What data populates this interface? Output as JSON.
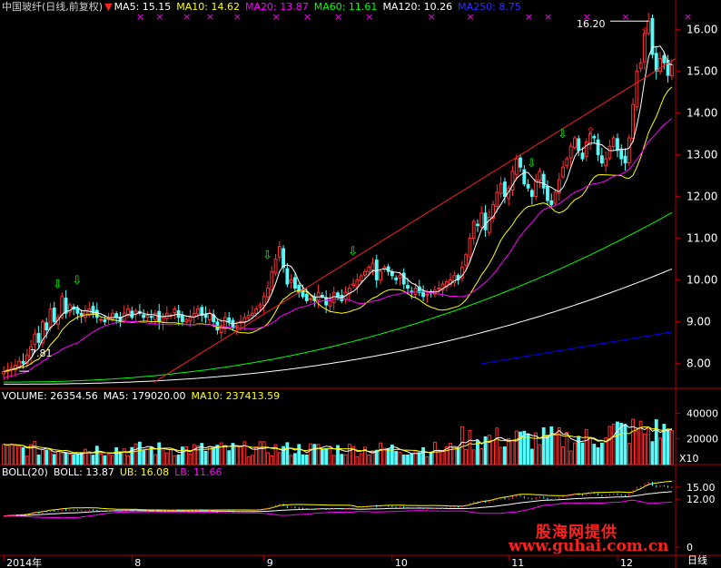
{
  "price_header": {
    "title": "中国玻纤(日线,前复权)",
    "ma5": "MA5: 15.15",
    "ma10": "MA10: 14.62",
    "ma20": "MA20: 13.87",
    "ma60": "MA60: 11.61",
    "ma120": "MA120: 10.26",
    "ma250": "MA250: 8.75"
  },
  "volume_header": {
    "vol": "VOLUME: 26354.56",
    "ma5": "MA5: 179020.00",
    "ma10": "MA10: 237413.59"
  },
  "boll_header": {
    "name": "BOLL(20)",
    "boll": "BOLL: 13.87",
    "ub": "UB: 16.08",
    "lb": "LB: 11.66"
  },
  "annotations": {
    "high": "16.20",
    "low": "7.81"
  },
  "volume_unit": "X10",
  "period_label": "日线",
  "watermark": {
    "line1": "股海网提供",
    "line2": "www.guhai.com.cn"
  },
  "colors": {
    "up": "#ff3232",
    "down": "#54fcfc",
    "ma5": "#ffffff",
    "ma10": "#ffff00",
    "ma20": "#ff00ff",
    "ma60": "#00ff00",
    "ma120": "#ffffff",
    "ma250": "#0000ff",
    "trend": "#ff2020",
    "axis": "#b00000"
  },
  "chart_data": [
    {
      "type": "candlestick",
      "title": "中国玻纤(日线,前复权)",
      "ylim": [
        7.4,
        16.4
      ],
      "y_ticks": [
        8.0,
        9.0,
        10.0,
        11.0,
        12.0,
        13.0,
        14.0,
        15.0,
        16.0
      ],
      "x_labels": [
        "2014年",
        "8",
        "9",
        "10",
        "11",
        "12"
      ],
      "x_label_index": [
        0,
        33,
        67,
        100,
        130,
        158
      ],
      "close_estimated": [
        7.8,
        7.85,
        7.9,
        7.95,
        8.05,
        8.0,
        8.2,
        8.4,
        8.7,
        8.5,
        9.0,
        8.8,
        9.3,
        9.0,
        9.1,
        9.6,
        9.2,
        9.4,
        9.3,
        9.2,
        9.15,
        9.25,
        9.3,
        9.2,
        9.1,
        9.05,
        9.0,
        9.1,
        9.2,
        9.1,
        9.0,
        9.2,
        9.3,
        9.1,
        9.25,
        9.2,
        9.1,
        9.15,
        9.1,
        9.2,
        9.0,
        9.1,
        9.2,
        9.15,
        9.3,
        9.1,
        9.0,
        9.05,
        9.1,
        9.2,
        9.3,
        9.15,
        9.1,
        9.2,
        9.0,
        8.8,
        8.9,
        9.1,
        9.0,
        8.85,
        8.9,
        9.0,
        9.1,
        9.15,
        9.2,
        9.3,
        9.4,
        9.6,
        9.8,
        10.2,
        10.5,
        10.8,
        10.3,
        9.9,
        10.0,
        9.8,
        9.7,
        9.6,
        9.5,
        9.55,
        9.5,
        9.7,
        9.6,
        9.4,
        9.5,
        9.7,
        9.6,
        9.5,
        9.7,
        9.8,
        9.9,
        10.0,
        10.1,
        10.2,
        10.3,
        10.4,
        10.0,
        10.2,
        10.3,
        10.2,
        10.1,
        10.0,
        10.1,
        9.9,
        9.8,
        9.7,
        9.8,
        9.7,
        9.6,
        9.65,
        9.7,
        9.75,
        9.8,
        9.9,
        9.95,
        10.0,
        10.1,
        10.0,
        10.3,
        10.6,
        11.0,
        11.4,
        11.3,
        11.6,
        11.2,
        11.5,
        11.8,
        12.1,
        12.3,
        12.0,
        12.2,
        12.6,
        12.9,
        12.7,
        12.3,
        12.2,
        12.0,
        12.4,
        12.6,
        12.2,
        11.9,
        11.8,
        12.1,
        12.4,
        12.7,
        12.9,
        13.2,
        13.4,
        13.1,
        12.9,
        13.3,
        13.5,
        13.4,
        13.0,
        12.8,
        12.9,
        13.2,
        13.4,
        13.1,
        12.9,
        12.8,
        13.4,
        14.2,
        15.0,
        15.2,
        15.9,
        16.2,
        15.4,
        15.0,
        15.3,
        15.2,
        14.9,
        15.15
      ],
      "ma5_end": 15.15,
      "ma10_end": 14.62,
      "ma20_end": 13.87,
      "ma60_end": 11.61,
      "ma120_end": 10.26,
      "ma250_end": 8.75,
      "annotations": [
        {
          "text": "16.20",
          "type": "high"
        },
        {
          "text": "7.81",
          "type": "low"
        }
      ]
    },
    {
      "type": "bar",
      "title": "VOLUME",
      "unit": "X10",
      "ylim": [
        0,
        48000
      ],
      "y_ticks": [
        20000,
        40000
      ],
      "last": 26354.56,
      "ma5": 179020.0,
      "ma10": 237413.59
    },
    {
      "type": "line",
      "title": "BOLL(20)",
      "ylim": [
        -2,
        17
      ],
      "y_ticks": [
        0,
        12.0,
        15.0
      ],
      "boll": 13.87,
      "ub": 16.08,
      "lb": 11.66
    }
  ]
}
